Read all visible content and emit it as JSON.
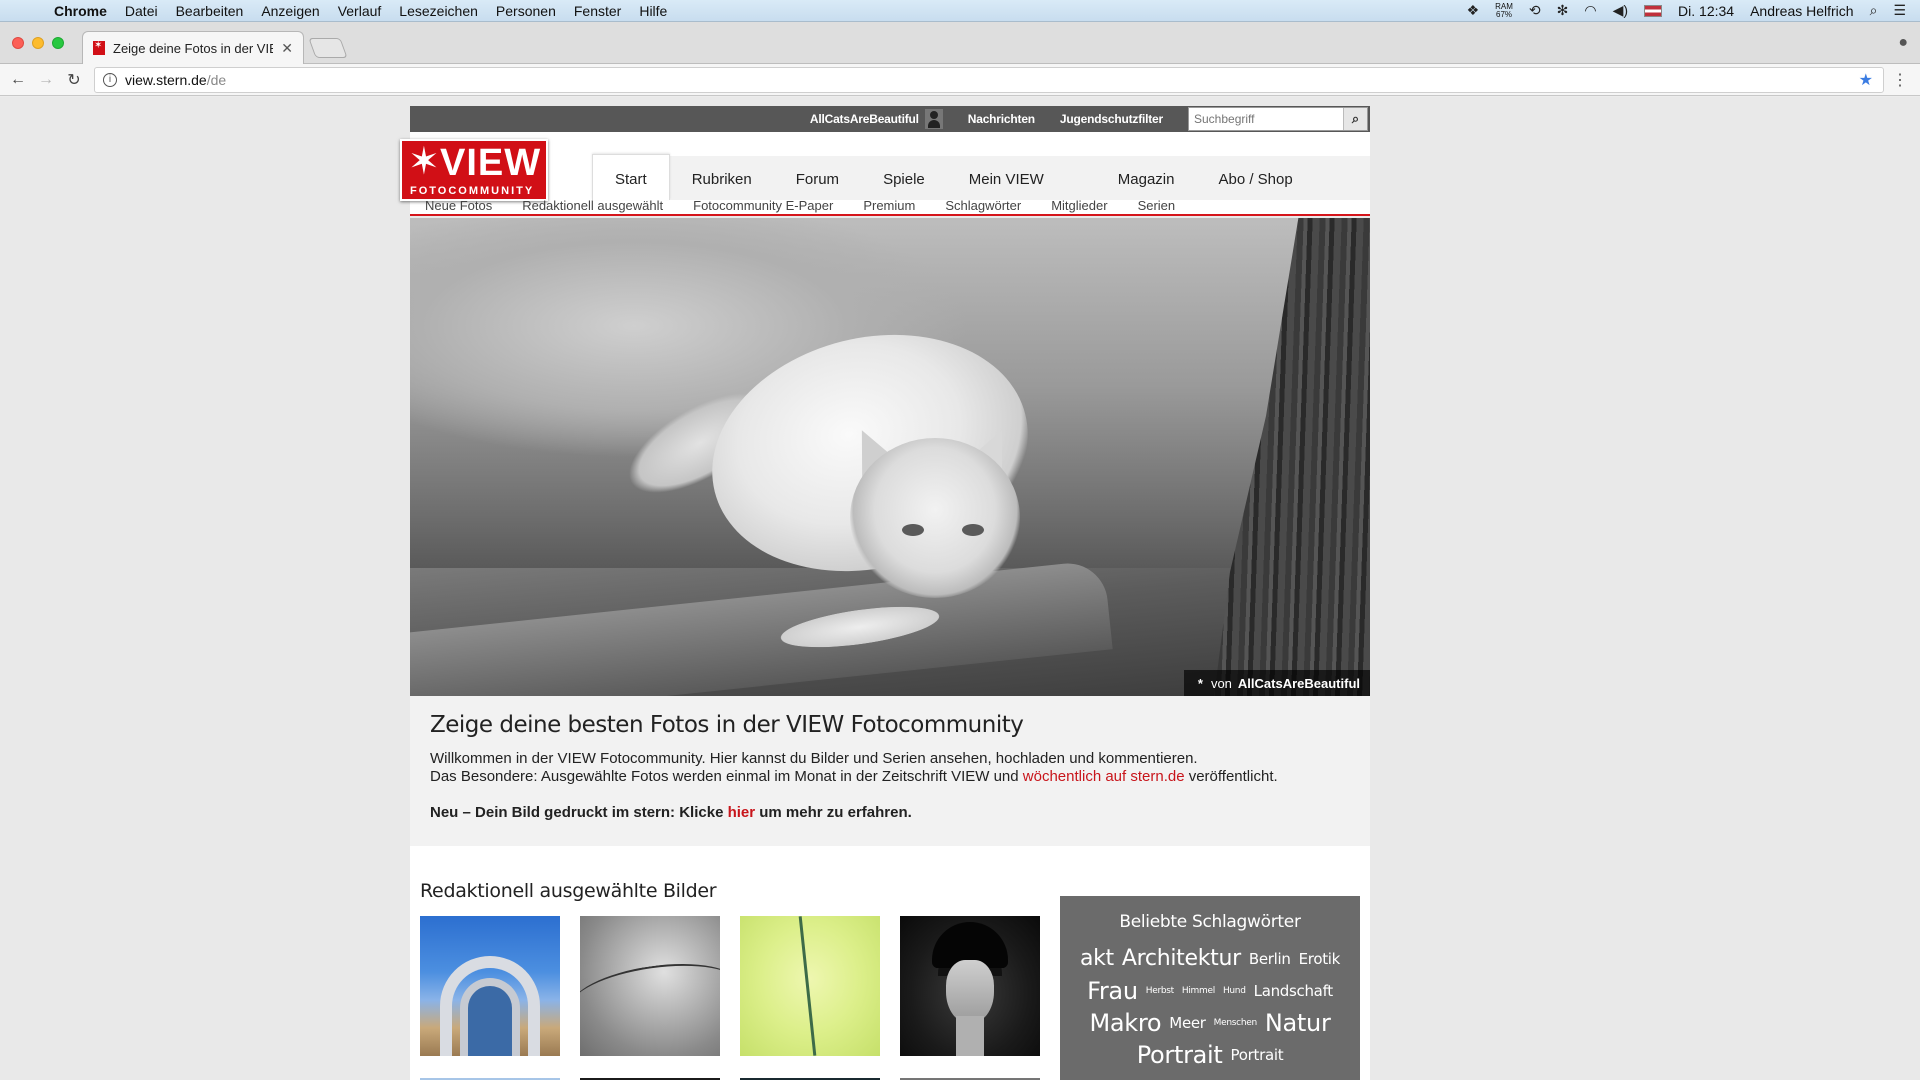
{
  "menubar": {
    "app": "Chrome",
    "items": [
      "Datei",
      "Bearbeiten",
      "Anzeigen",
      "Verlauf",
      "Lesezeichen",
      "Personen",
      "Fenster",
      "Hilfe"
    ],
    "ram_label": "RAM",
    "ram_value": "67%",
    "clock": "Di. 12:34",
    "user": "Andreas Helfrich"
  },
  "browser": {
    "tab_title": "Zeige deine Fotos in der VIEW",
    "url_host": "view.stern.de",
    "url_path": "/de",
    "icons": {
      "back": "arrow-left-icon",
      "forward": "arrow-right-icon",
      "reload": "reload-icon",
      "info": "info-icon",
      "bookmark": "star-icon",
      "menu": "kebab-menu-icon",
      "profile": "profile-icon"
    }
  },
  "site": {
    "brand_color": "#d10f16",
    "logo": {
      "main": "VIEW",
      "sub": "FOTOCOMMUNITY"
    },
    "topbar": {
      "username": "AllCatsAreBeautiful",
      "links": [
        "Nachrichten",
        "Jugendschutzfilter"
      ],
      "search_placeholder": "Suchbegriff"
    },
    "main_nav": [
      "Start",
      "Rubriken",
      "Forum",
      "Spiele",
      "Mein VIEW",
      "Magazin",
      "Abo / Shop"
    ],
    "main_nav_active": "Start",
    "sub_nav": [
      "Neue Fotos",
      "Redaktionell ausgewählt",
      "Fotocommunity E-Paper",
      "Premium",
      "Schlagwörter",
      "Mitglieder",
      "Serien"
    ],
    "hero": {
      "credit_mark": "*",
      "credit_von": "von",
      "credit_user": "AllCatsAreBeautiful"
    },
    "intro": {
      "title": "Zeige deine besten Fotos in der VIEW Fotocommunity",
      "line1": "Willkommen in der VIEW Fotocommunity. Hier kannst du Bilder und Serien ansehen, hochladen und kommentieren.",
      "line2_pre": "Das Besondere: Ausgewählte Fotos werden einmal im Monat in der Zeitschrift VIEW und ",
      "line2_link": "wöchentlich auf stern.de",
      "line2_post": " veröffentlicht.",
      "neu_pre": "Neu – Dein Bild gedruckt im stern: Klicke ",
      "neu_link": "hier",
      "neu_post": " um mehr zu erfahren."
    },
    "selected_title": "Redaktionell ausgewählte Bilder",
    "tagcloud": {
      "title": "Beliebte Schlagwörter",
      "tags": [
        {
          "text": "akt",
          "size": 4
        },
        {
          "text": "Architektur",
          "size": 4
        },
        {
          "text": "Berlin",
          "size": 3
        },
        {
          "text": "Erotik",
          "size": 3
        },
        {
          "text": "Frau",
          "size": 5
        },
        {
          "text": "Herbst",
          "size": 1
        },
        {
          "text": "Himmel",
          "size": 1
        },
        {
          "text": "Hund",
          "size": 1
        },
        {
          "text": "Landschaft",
          "size": 3
        },
        {
          "text": "Makro",
          "size": 5
        },
        {
          "text": "Meer",
          "size": 3
        },
        {
          "text": "Menschen",
          "size": 1
        },
        {
          "text": "Natur",
          "size": 5
        },
        {
          "text": "Portrait",
          "size": 5
        },
        {
          "text": "Portrait",
          "size": 3
        }
      ]
    }
  }
}
